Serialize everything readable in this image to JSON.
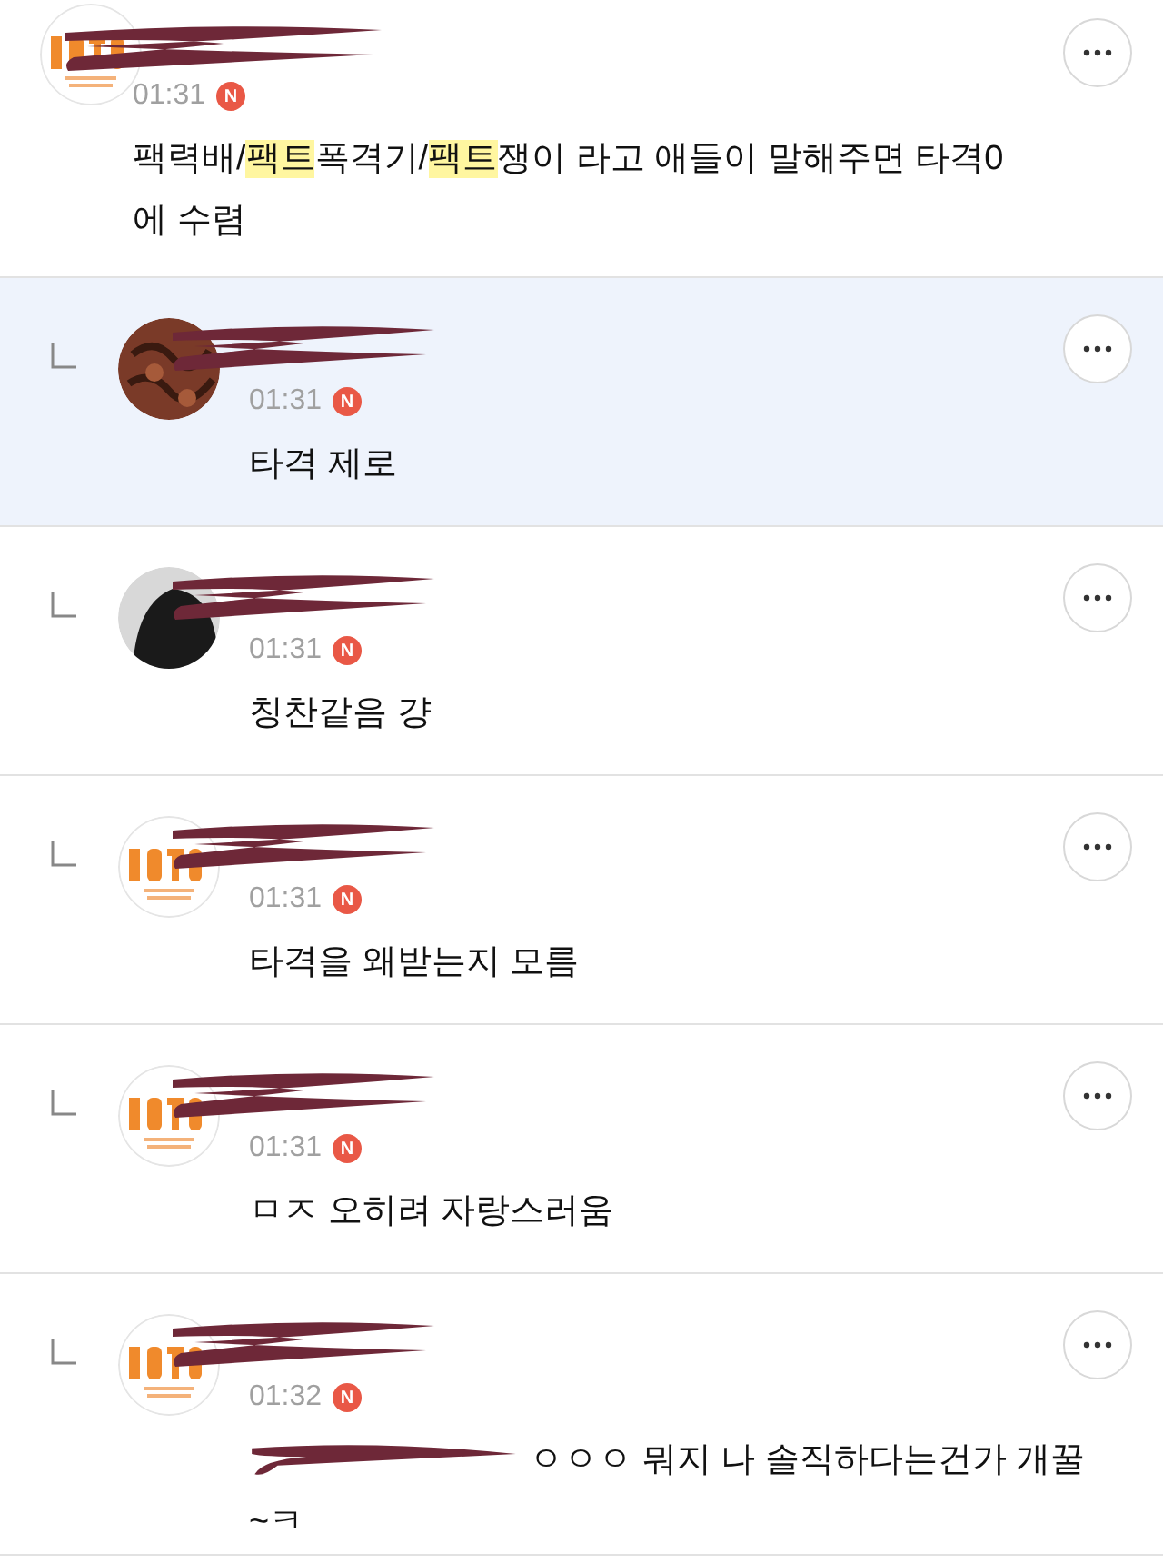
{
  "comments": [
    {
      "reply": false,
      "selected": false,
      "avatar": {
        "kind": "logo"
      },
      "time": "01:31",
      "badge": "N",
      "lines": [
        [
          {
            "text": "팩력배/",
            "highlight": false
          },
          {
            "text": "팩트",
            "highlight": true
          },
          {
            "text": "폭격기/",
            "highlight": false
          },
          {
            "text": "팩트",
            "highlight": true
          },
          {
            "text": "쟁이 라고 애들이 말해주면 타격0",
            "highlight": false
          }
        ],
        [
          {
            "text": "에 수렴",
            "highlight": false
          }
        ]
      ],
      "redacted_start": false
    },
    {
      "reply": true,
      "selected": true,
      "avatar": {
        "kind": "pattern"
      },
      "time": "01:31",
      "badge": "N",
      "lines": [
        [
          {
            "text": "타격 제로",
            "highlight": false
          }
        ]
      ],
      "redacted_start": false
    },
    {
      "reply": true,
      "selected": false,
      "avatar": {
        "kind": "photo"
      },
      "time": "01:31",
      "badge": "N",
      "lines": [
        [
          {
            "text": "칭찬같음 걍",
            "highlight": false
          }
        ]
      ],
      "redacted_start": false
    },
    {
      "reply": true,
      "selected": false,
      "avatar": {
        "kind": "logo"
      },
      "time": "01:31",
      "badge": "N",
      "lines": [
        [
          {
            "text": "타격을 왜받는지 모름",
            "highlight": false
          }
        ]
      ],
      "redacted_start": false
    },
    {
      "reply": true,
      "selected": false,
      "avatar": {
        "kind": "logo"
      },
      "time": "01:31",
      "badge": "N",
      "lines": [
        [
          {
            "text": "ㅁㅈ 오히려 자랑스러움",
            "highlight": false
          }
        ]
      ],
      "redacted_start": false
    },
    {
      "reply": true,
      "selected": false,
      "avatar": {
        "kind": "logo"
      },
      "time": "01:32",
      "badge": "N",
      "lines": [
        [
          {
            "text": "ㅇㅇㅇ 뭐지 나 솔직하다는건가 개꿀",
            "highlight": false
          }
        ],
        [
          {
            "text": "~ㅋ",
            "highlight": false
          }
        ]
      ],
      "redacted_start": true
    }
  ]
}
